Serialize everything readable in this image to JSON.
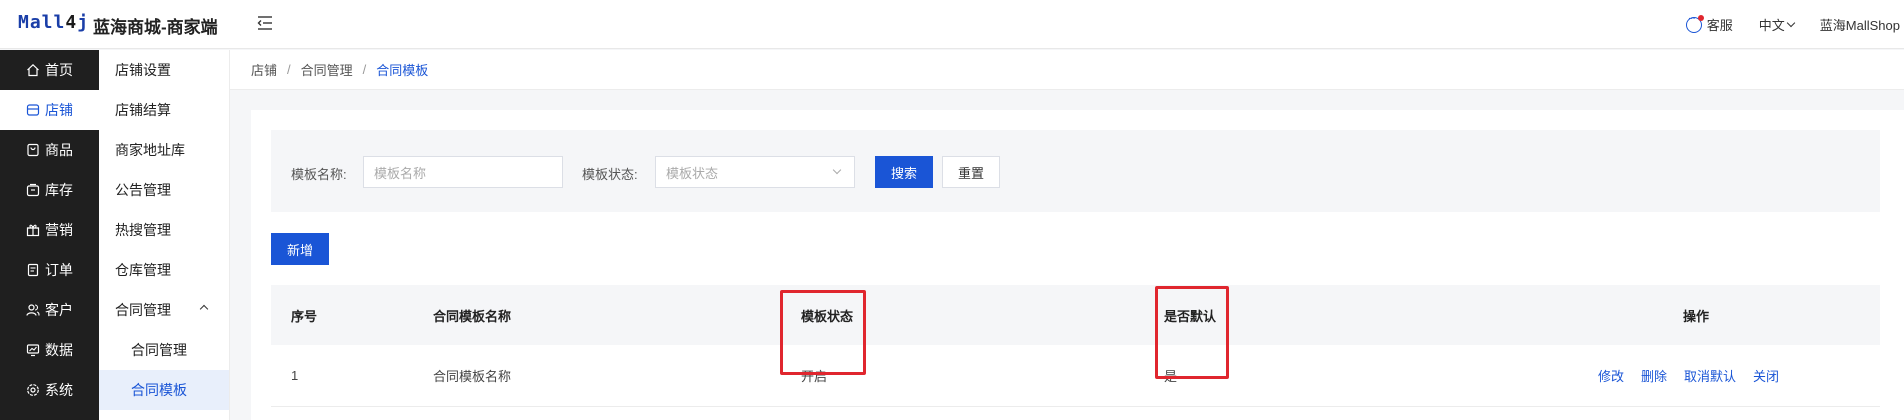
{
  "header": {
    "logo_main": "Mall",
    "logo_four": "4",
    "logo_j": "j",
    "app_title": "蓝海商城-商家端",
    "service_label": "客服",
    "language_label": "中文",
    "user_label": "蓝海MallShop"
  },
  "main_nav": [
    {
      "label": "首页",
      "icon": "home-icon"
    },
    {
      "label": "店铺",
      "icon": "store-icon",
      "active": true
    },
    {
      "label": "商品",
      "icon": "product-icon"
    },
    {
      "label": "库存",
      "icon": "inventory-icon"
    },
    {
      "label": "营销",
      "icon": "marketing-icon"
    },
    {
      "label": "订单",
      "icon": "order-icon"
    },
    {
      "label": "客户",
      "icon": "customer-icon"
    },
    {
      "label": "数据",
      "icon": "data-icon"
    },
    {
      "label": "系统",
      "icon": "settings-icon"
    }
  ],
  "sub_nav": [
    {
      "label": "店铺设置"
    },
    {
      "label": "店铺结算"
    },
    {
      "label": "商家地址库"
    },
    {
      "label": "公告管理"
    },
    {
      "label": "热搜管理"
    },
    {
      "label": "仓库管理"
    },
    {
      "label": "合同管理",
      "expanded": true
    },
    {
      "label": "合同管理",
      "child": true
    },
    {
      "label": "合同模板",
      "child": true,
      "active": true
    }
  ],
  "breadcrumb": [
    "店铺",
    "合同管理",
    "合同模板"
  ],
  "search": {
    "name_label": "模板名称:",
    "name_placeholder": "模板名称",
    "status_label": "模板状态:",
    "status_placeholder": "模板状态",
    "search_button": "搜索",
    "reset_button": "重置"
  },
  "add_button": "新增",
  "table": {
    "columns": [
      "序号",
      "合同模板名称",
      "模板状态",
      "是否默认",
      "操作"
    ],
    "rows": [
      {
        "index": "1",
        "name": "合同模板名称",
        "status": "开启",
        "is_default": "是",
        "actions": [
          "修改",
          "删除",
          "取消默认",
          "关闭"
        ]
      }
    ]
  },
  "colors": {
    "primary": "#1a55d6",
    "highlight": "#e0262e",
    "sidebar_dark": "#1f1f1f"
  }
}
